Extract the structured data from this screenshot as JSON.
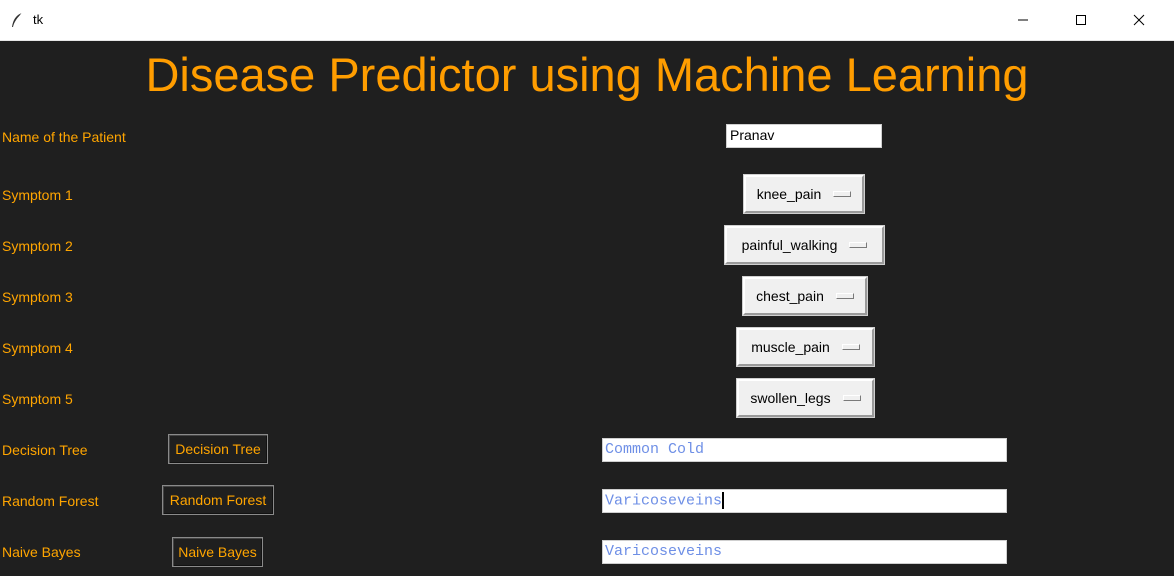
{
  "window": {
    "title": "tk",
    "icons": {
      "app": "feather-icon",
      "minimize": "minimize-icon",
      "maximize": "maximize-icon",
      "close": "close-icon"
    }
  },
  "heading": "Disease Predictor using Machine Learning",
  "colors": {
    "background": "#1f1f1f",
    "accent": "#ffa500",
    "heading": "#ff9d00",
    "result_text": "#6e8fe6"
  },
  "patient": {
    "label": "Name of the Patient",
    "value": "Pranav"
  },
  "symptoms": [
    {
      "label": "Symptom 1",
      "value": "knee_pain"
    },
    {
      "label": "Symptom 2",
      "value": "painful_walking"
    },
    {
      "label": "Symptom 3",
      "value": "chest_pain"
    },
    {
      "label": "Symptom 4",
      "value": "muscle_pain"
    },
    {
      "label": "Symptom 5",
      "value": "swollen_legs"
    }
  ],
  "algorithms": [
    {
      "label": "Decision Tree",
      "button": "Decision Tree",
      "result": "Common Cold"
    },
    {
      "label": "Random Forest",
      "button": "Random Forest",
      "result": "Varicoseveins"
    },
    {
      "label": "Naive Bayes",
      "button": "Naive Bayes",
      "result": "Varicoseveins"
    }
  ]
}
